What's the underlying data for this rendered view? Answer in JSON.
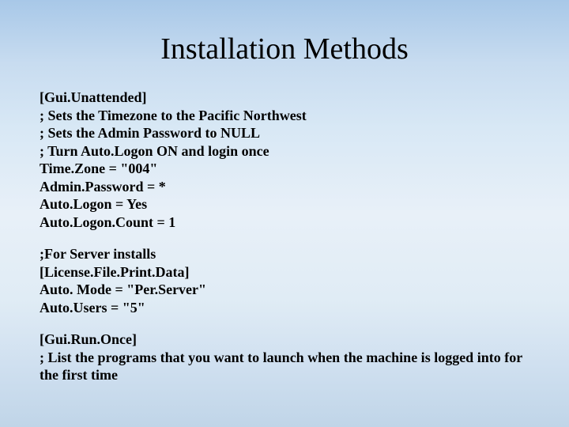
{
  "title": "Installation Methods",
  "block1": {
    "l1": "[Gui.Unattended]",
    "l2": "; Sets the Timezone to the Pacific Northwest",
    "l3": "; Sets the Admin Password to NULL",
    "l4": "; Turn Auto.Logon ON and login once",
    "l5": "Time.Zone = \"004\"",
    "l6": "Admin.Password = *",
    "l7": "Auto.Logon = Yes",
    "l8": "Auto.Logon.Count = 1"
  },
  "block2": {
    "l1": ";For Server installs",
    "l2": "[License.File.Print.Data]",
    "l3": "Auto. Mode = \"Per.Server\"",
    "l4": "Auto.Users = \"5\""
  },
  "block3": {
    "l1": "[Gui.Run.Once]",
    "l2": "; List the programs that you want to launch when the machine is logged into for the first time"
  }
}
